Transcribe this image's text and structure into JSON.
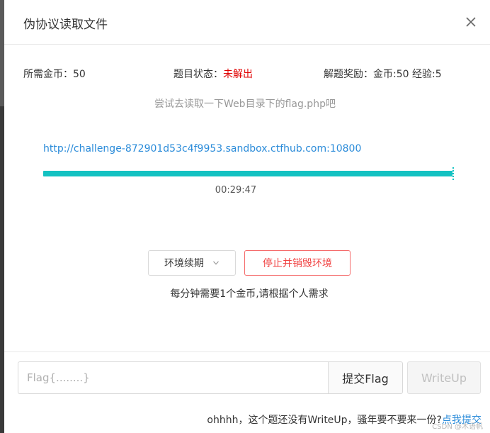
{
  "dialog": {
    "title": "伪协议读取文件",
    "close_icon": "close-icon"
  },
  "info": {
    "coin_label": "所需金币：",
    "coin_value": "50",
    "status_label": "题目状态：",
    "status_value": "未解出",
    "reward_label": "解题奖励：",
    "reward_value": "金币:50 经验:5"
  },
  "hint": "尝试去读取一下Web目录下的flag.php吧",
  "environment": {
    "url": "http://challenge-872901d53c4f9953.sandbox.ctfhub.com:10800",
    "remaining_time": "00:29:47",
    "remaining_fraction": 1.0
  },
  "actions": {
    "renew_label": "环境续期",
    "renew_icon": "chevron-down-icon",
    "destroy_label": "停止并销毁环境",
    "cost_note": "每分钟需要1个金币,请根据个人需求"
  },
  "flag_form": {
    "placeholder": "Flag{........}",
    "value": "",
    "submit_label": "提交Flag",
    "writeup_label": "WriteUp"
  },
  "footer": {
    "note": "ohhhh，这个题还没有WriteUp，骚年要不要来一份?",
    "link_label": "点我提交",
    "watermark": "CSDN @木语帆"
  },
  "colors": {
    "accent_teal": "#13c2c2",
    "link_blue": "#2a8bd9",
    "status_red": "#e00000",
    "danger_border": "#f56c6c"
  }
}
